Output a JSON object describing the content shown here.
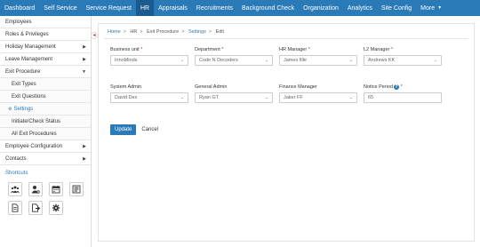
{
  "topnav": {
    "items": [
      {
        "label": "Dashboard"
      },
      {
        "label": "Self Service"
      },
      {
        "label": "Service Request"
      },
      {
        "label": "HR",
        "active": true
      },
      {
        "label": "Appraisals"
      },
      {
        "label": "Recruitments"
      },
      {
        "label": "Background Check"
      },
      {
        "label": "Organization"
      },
      {
        "label": "Analytics"
      },
      {
        "label": "Site Config"
      }
    ],
    "more_label": "More",
    "active_color": "#1a5a8e",
    "bar_color": "#2b7ab8"
  },
  "sidebar": {
    "collapse_icon": "chevron-left-icon",
    "items": [
      {
        "label": "Employees",
        "has_arrow": false
      },
      {
        "label": "Roles & Privileges",
        "has_arrow": false
      },
      {
        "label": "Holiday Management",
        "has_arrow": true
      },
      {
        "label": "Leave Management",
        "has_arrow": true
      },
      {
        "label": "Exit Procedure",
        "has_arrow": true
      }
    ],
    "sub_items": [
      {
        "label": "Exit Types"
      },
      {
        "label": "Exit Questions"
      },
      {
        "label": "Settings",
        "active": true
      },
      {
        "label": "Initiate/Check Status"
      },
      {
        "label": "All Exit Procedures"
      }
    ],
    "items_after": [
      {
        "label": "Employee Configuration",
        "has_arrow": true
      },
      {
        "label": "Contacts",
        "has_arrow": true
      }
    ],
    "shortcuts_title": "Shortcuts",
    "shortcuts": [
      "users-group-icon",
      "user-settings-icon",
      "calendar-icon",
      "id-card-icon",
      "document-icon",
      "document-export-icon",
      "gear-icon"
    ]
  },
  "breadcrumb": {
    "items": [
      "Home",
      "HR",
      "Exit Procedure",
      "Settings",
      "Edit"
    ],
    "separator": ">"
  },
  "form": {
    "business_unit": {
      "label": "Business unit",
      "required": true,
      "value": "InnoMinds"
    },
    "department": {
      "label": "Department",
      "required": true,
      "value": "Code N Decoders"
    },
    "hr_manager": {
      "label": "HR Manager",
      "required": true,
      "value": "James fille"
    },
    "l2_manager": {
      "label": "L2 Manager",
      "required": true,
      "value": "Andrews KK"
    },
    "system_admin": {
      "label": "System Admin",
      "required": false,
      "value": "David Dex"
    },
    "general_admin": {
      "label": "General Admin",
      "required": false,
      "value": "Ryan GT"
    },
    "finance_manager": {
      "label": "Finance Manager",
      "required": false,
      "value": "Jaker FF"
    },
    "notice_period": {
      "label": "Notice Period",
      "required": true,
      "value": "65",
      "help_icon": "question-circle-icon"
    },
    "required_marker": "*",
    "update_label": "Update",
    "cancel_label": "Cancel"
  }
}
